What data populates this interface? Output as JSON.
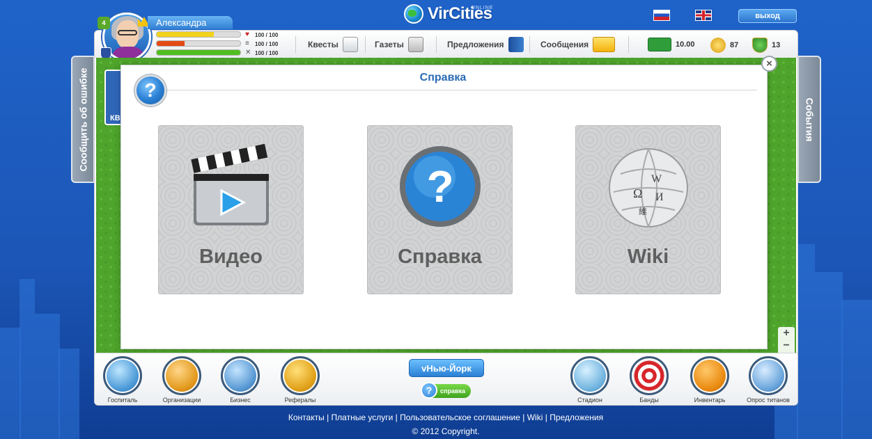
{
  "app": {
    "logo_text": "VirCities",
    "logo_suffix": "ONLINE"
  },
  "header": {
    "exit_label": "выход",
    "languages": [
      "ru",
      "en"
    ]
  },
  "player": {
    "name": "Александра",
    "stats": [
      {
        "icon": "heart-icon",
        "value": "100 / 100",
        "fill": 0.68,
        "color": "#f3d21b"
      },
      {
        "icon": "food-icon",
        "value": "100 / 100",
        "fill": 0.33,
        "color": "#e44b14"
      },
      {
        "icon": "tools-icon",
        "value": "100 / 100",
        "fill": 1.0,
        "color": "#4fbf1f"
      }
    ],
    "level": "4"
  },
  "topnav": {
    "quests": "Квесты",
    "newspapers": "Газеты",
    "offers": "Предложения",
    "messages": "Сообщения"
  },
  "currency": {
    "money": "10.00",
    "coins": "87",
    "rank": "13"
  },
  "side_tabs": {
    "left": "Сообщить об ошибке",
    "right": "События"
  },
  "map": {
    "quest_card_label": "КВ"
  },
  "dialog": {
    "title": "Справка",
    "tiles": [
      {
        "label": "Видео",
        "icon": "video-clapper-icon"
      },
      {
        "label": "Справка",
        "icon": "help-question-icon"
      },
      {
        "label": "Wiki",
        "icon": "wikipedia-globe-icon"
      }
    ]
  },
  "bottom_bar": {
    "left": [
      {
        "label": "Госпиталь",
        "icon": "hospital-icon"
      },
      {
        "label": "Организации",
        "icon": "organizations-icon"
      },
      {
        "label": "Бизнес",
        "icon": "business-icon"
      },
      {
        "label": "Рефералы",
        "icon": "referrals-icon"
      }
    ],
    "right": [
      {
        "label": "Стадион",
        "icon": "stadium-icon"
      },
      {
        "label": "Банды",
        "icon": "gangs-icon"
      },
      {
        "label": "Инвентарь",
        "icon": "inventory-icon"
      },
      {
        "label": "Опрос титанов",
        "icon": "titans-poll-icon"
      }
    ],
    "city_button": "vНью-Йорк",
    "help_pill": "справка"
  },
  "footer": {
    "links": [
      "Контакты",
      "Платные услуги",
      "Пользовательское соглашение",
      "Wiki",
      "Предложения"
    ],
    "copyright": "© 2012 Copyright."
  },
  "colors": {
    "accent": "#2a7fd3",
    "title_blue": "#2a6bb5",
    "map_green": "#4fa42c"
  }
}
